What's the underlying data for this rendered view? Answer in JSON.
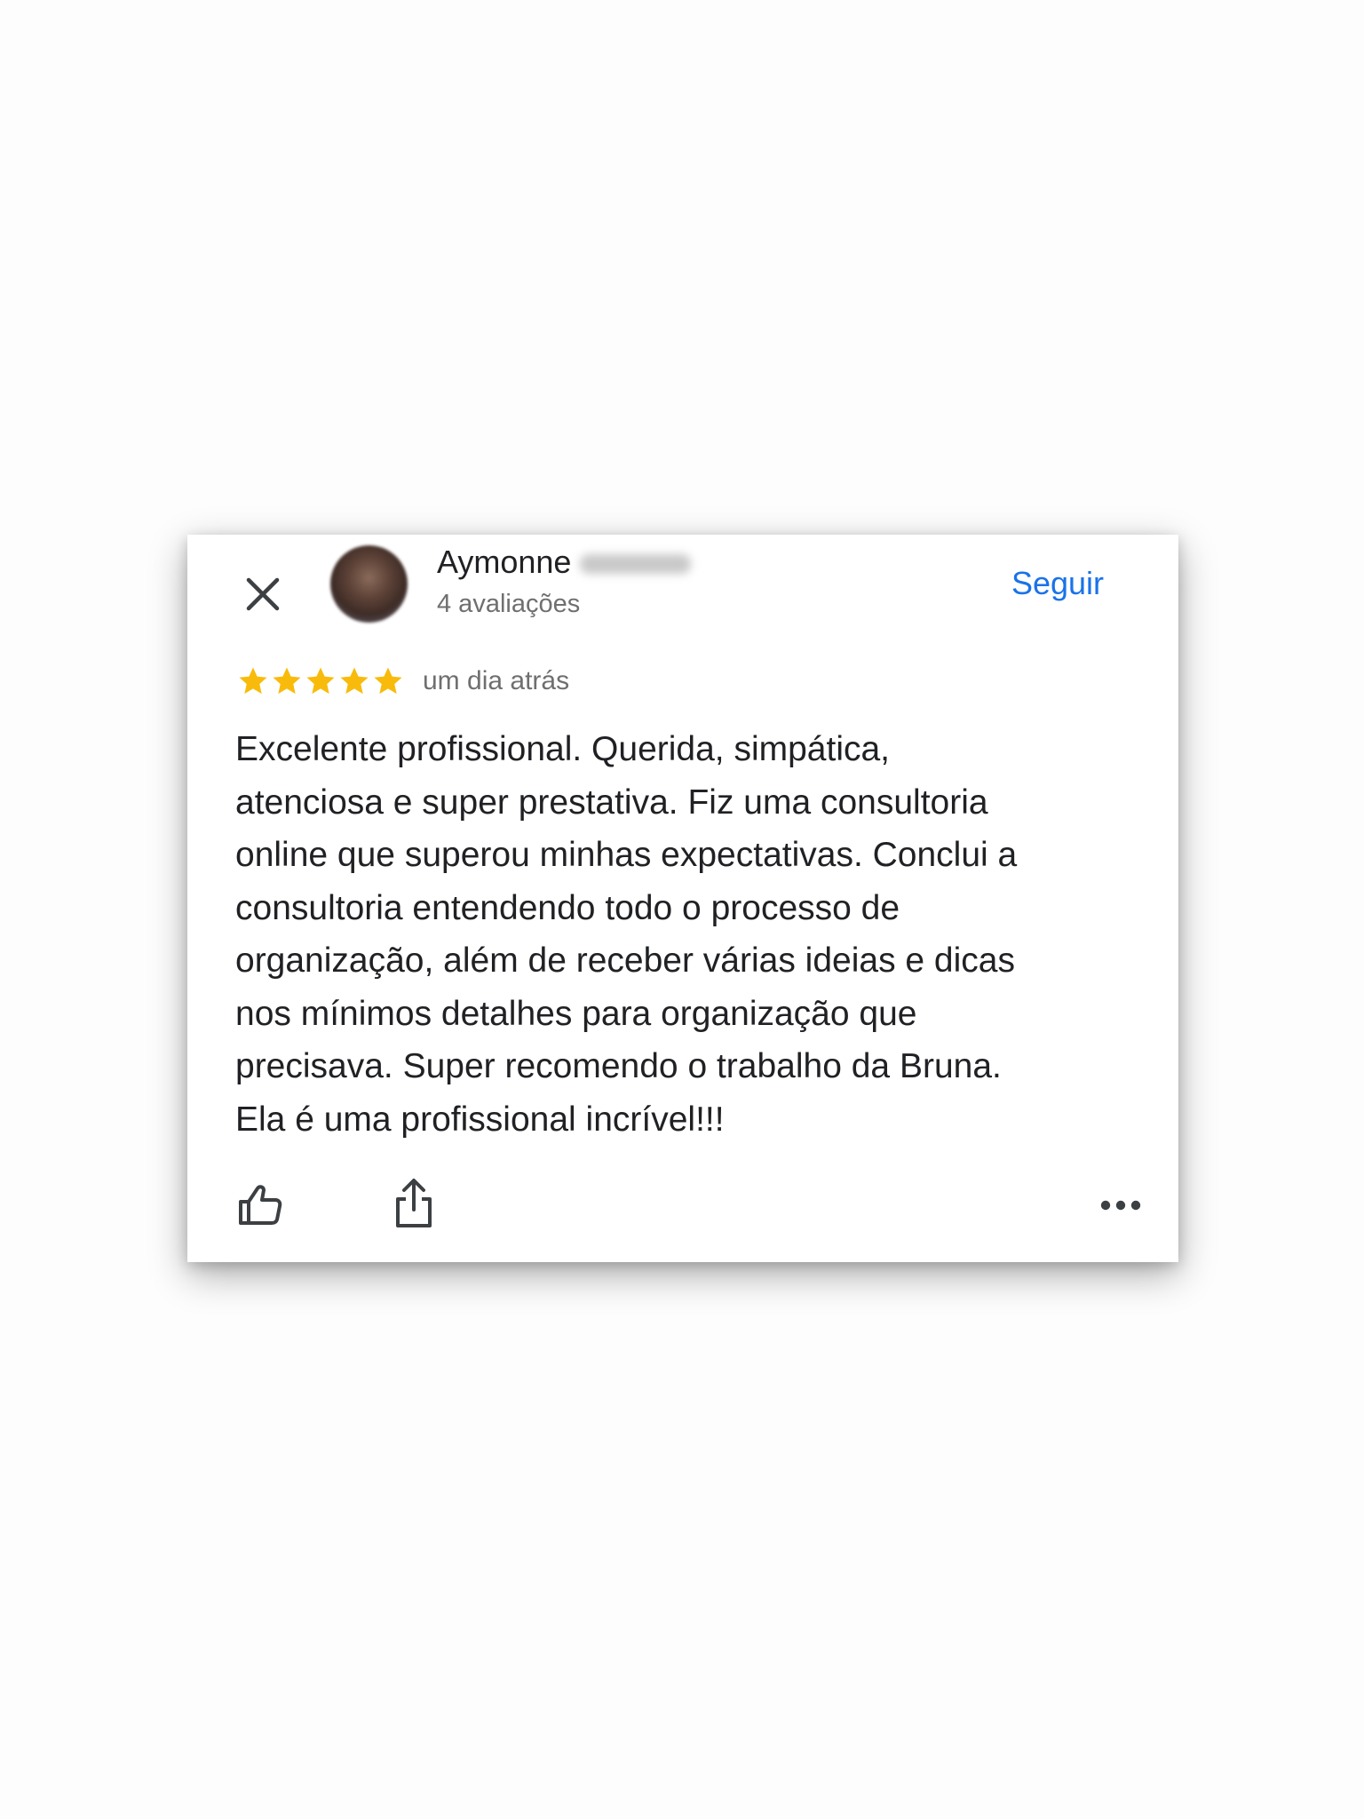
{
  "review": {
    "reviewer": {
      "name": "Aymonne",
      "review_count": "4 avaliações"
    },
    "follow_label": "Seguir",
    "rating": 5,
    "max_rating": 5,
    "date": "um dia atrás",
    "text": "Excelente profissional. Querida, simpática,\natenciosa e super prestativa. Fiz uma consultoria\nonline que superou minhas expectativas. Conclui a\nconsultoria entendendo todo o processo de\norganização, além de receber várias ideias e dicas\nnos mínimos detalhes para organização que\nprecisava. Super recomendo o trabalho da Bruna.\nEla é uma profissional incrível!!!",
    "icons": {
      "close": "close-icon",
      "star": "star-icon",
      "like": "thumbs-up-icon",
      "share": "share-icon",
      "more": "more-horizontal-icon"
    }
  },
  "colors": {
    "accent": "#1a73e8",
    "star": "#f9bb0b",
    "text": "#202124",
    "secondary_text": "#6f6f6f",
    "icon": "#3c4043"
  }
}
